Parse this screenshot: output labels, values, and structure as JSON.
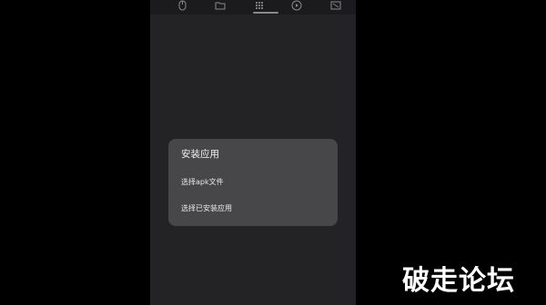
{
  "toolbar": {
    "tabs": [
      {
        "icon": "mouse-icon"
      },
      {
        "icon": "folder-icon"
      },
      {
        "icon": "apps-grid-icon",
        "active": true
      },
      {
        "icon": "play-icon"
      },
      {
        "icon": "display-icon"
      }
    ]
  },
  "dialog": {
    "title": "安装应用",
    "options": [
      {
        "label": "选择apk文件"
      },
      {
        "label": "选择已安装应用"
      }
    ]
  },
  "watermark": {
    "text": "破走论坛"
  },
  "colors": {
    "background": "#000000",
    "screen": "#232325",
    "dialog": "#47474a",
    "text": "#f2f2f2"
  }
}
